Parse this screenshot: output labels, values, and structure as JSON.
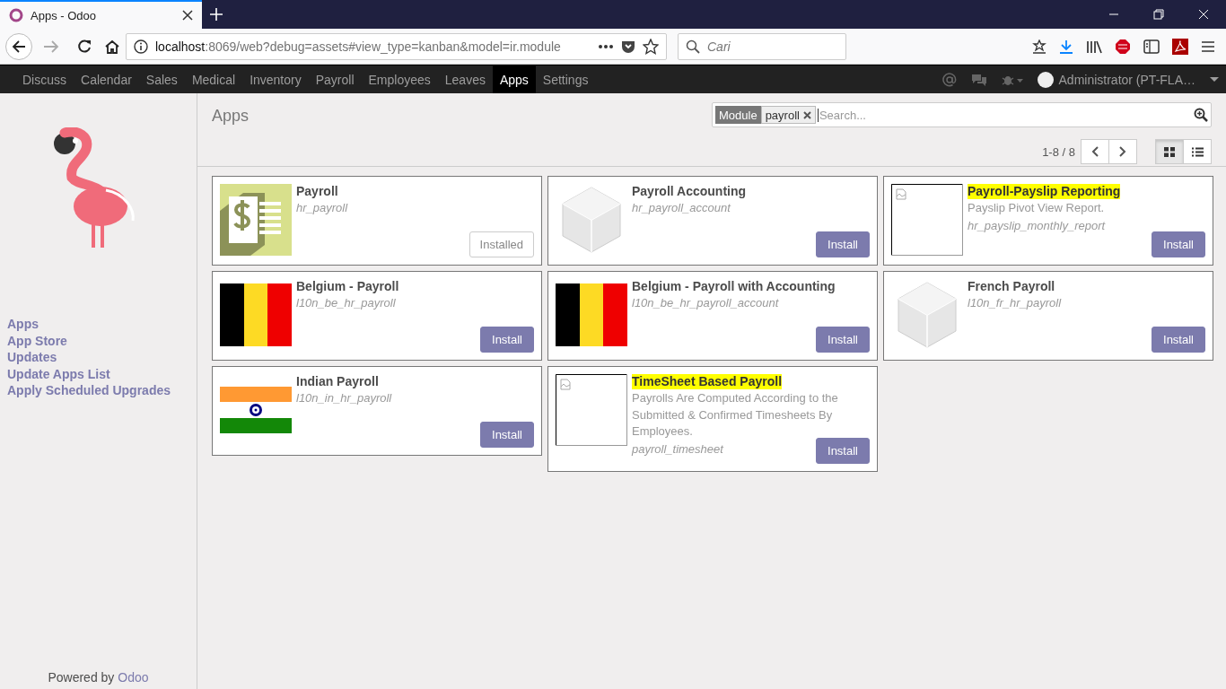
{
  "browser": {
    "tab_title": "Apps - Odoo",
    "url_host": "localhost",
    "url_rest": ":8069/web?debug=assets#view_type=kanban&model=ir.module",
    "search_placeholder": "Cari"
  },
  "navbar": {
    "menu": [
      {
        "label": "Discuss",
        "selected": false
      },
      {
        "label": "Calendar",
        "selected": false
      },
      {
        "label": "Sales",
        "selected": false
      },
      {
        "label": "Medical",
        "selected": false
      },
      {
        "label": "Inventory",
        "selected": false
      },
      {
        "label": "Payroll",
        "selected": false
      },
      {
        "label": "Employees",
        "selected": false
      },
      {
        "label": "Leaves",
        "selected": false
      },
      {
        "label": "Apps",
        "selected": true
      },
      {
        "label": "Settings",
        "selected": false
      }
    ],
    "user": "Administrator (PT-FLA…"
  },
  "sidebar": {
    "items": [
      "Apps",
      "App Store",
      "Updates",
      "Update Apps List",
      "Apply Scheduled Upgrades"
    ],
    "powered_by": "Powered by",
    "brand": "Odoo"
  },
  "control_panel": {
    "breadcrumb": "Apps",
    "facet": {
      "field": "Module",
      "value": "payroll"
    },
    "search_placeholder": "Search...",
    "pager": "1-8 / 8",
    "views": [
      {
        "kind": "kanban",
        "selected": true
      },
      {
        "kind": "list",
        "selected": false
      }
    ]
  },
  "apps": [
    {
      "name": "Payroll",
      "highlighted": false,
      "technical_name": "hr_payroll",
      "kind": "payroll",
      "button": {
        "label": "Installed",
        "installed": true
      }
    },
    {
      "name": "Payroll Accounting",
      "highlighted": false,
      "technical_name": "hr_payroll_account",
      "kind": "cube",
      "button": {
        "label": "Install",
        "installed": false
      }
    },
    {
      "name": "Payroll-Payslip Reporting",
      "highlighted": true,
      "description": "Payslip Pivot View Report.",
      "technical_name": "hr_payslip_monthly_report",
      "kind": "missing",
      "button": {
        "label": "Install",
        "installed": false
      }
    },
    {
      "name": "Belgium - Payroll",
      "highlighted": false,
      "technical_name": "l10n_be_hr_payroll",
      "kind": "belgium",
      "button": {
        "label": "Install",
        "installed": false
      }
    },
    {
      "name": "Belgium - Payroll with Accounting",
      "highlighted": false,
      "technical_name": "l10n_be_hr_payroll_account",
      "kind": "belgium",
      "button": {
        "label": "Install",
        "installed": false
      }
    },
    {
      "name": "French Payroll",
      "highlighted": false,
      "technical_name": "l10n_fr_hr_payroll",
      "kind": "cube",
      "button": {
        "label": "Install",
        "installed": false
      }
    },
    {
      "name": "Indian Payroll",
      "highlighted": false,
      "technical_name": "l10n_in_hr_payroll",
      "kind": "india",
      "button": {
        "label": "Install",
        "installed": false
      }
    },
    {
      "name": "TimeSheet Based Payroll",
      "highlighted": true,
      "description": "Payrolls Are Computed According to the Submitted & Confirmed Timesheets By Employees.",
      "technical_name": "payroll_timesheet",
      "kind": "missing",
      "button": {
        "label": "Install",
        "installed": false
      }
    }
  ]
}
